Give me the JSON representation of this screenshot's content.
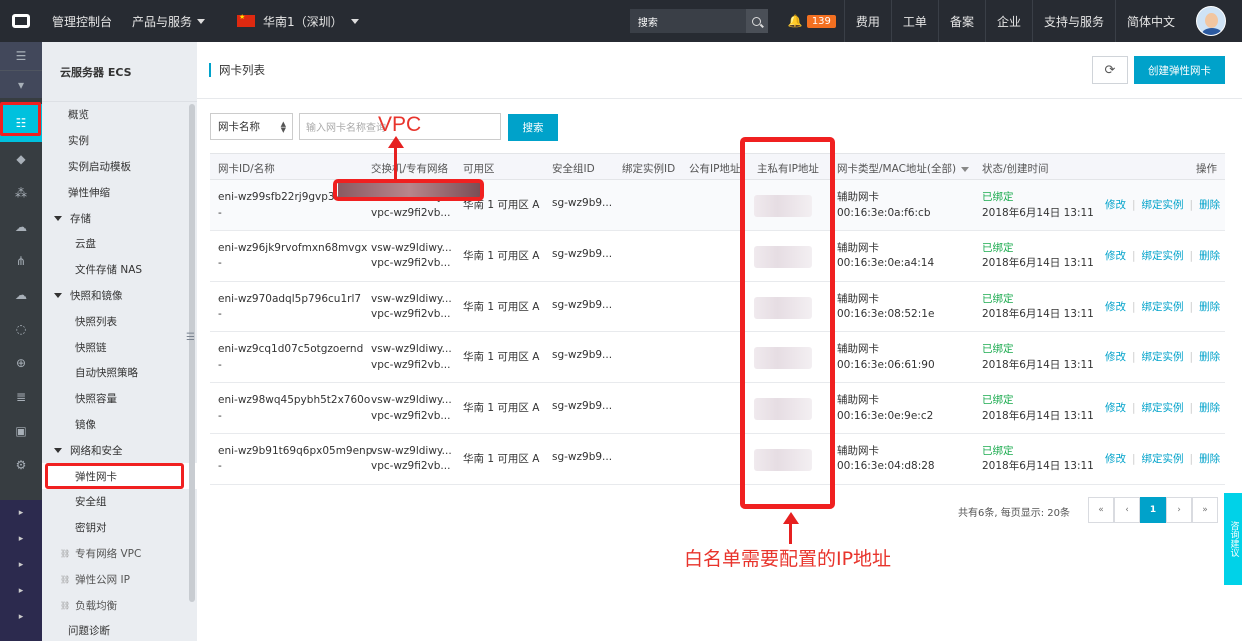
{
  "topbar": {
    "console": "管理控制台",
    "products": "产品与服务",
    "region": "华南1（深圳）",
    "search_placeholder": "搜索",
    "bell_count": "139",
    "links": [
      "费用",
      "工单",
      "备案",
      "企业",
      "支持与服务",
      "简体中文"
    ]
  },
  "rail": {
    "top_icons": [
      "menu-icon",
      "arrow-down-icon"
    ],
    "icons": [
      "ecs-icon",
      "cube-icon",
      "share-icon",
      "cloud-icon",
      "cluster-icon",
      "cloud-upload-icon",
      "cloud-outline-icon",
      "network-icon",
      "storage-icon",
      "chip-icon",
      "gear-icon",
      "more-icon"
    ],
    "lower_icons": [
      "chevron-right-icon",
      "chevron-right-icon",
      "chevron-right-icon",
      "chevron-right-icon",
      "chevron-right-icon"
    ]
  },
  "nav": {
    "title": "云服务器 ECS",
    "items": [
      {
        "label": "概览",
        "type": "item"
      },
      {
        "label": "实例",
        "type": "item"
      },
      {
        "label": "实例启动模板",
        "type": "item"
      },
      {
        "label": "弹性伸缩",
        "type": "item"
      },
      {
        "label": "存储",
        "type": "group"
      },
      {
        "label": "云盘",
        "type": "sub"
      },
      {
        "label": "文件存储 NAS",
        "type": "sub"
      },
      {
        "label": "快照和镜像",
        "type": "group"
      },
      {
        "label": "快照列表",
        "type": "sub"
      },
      {
        "label": "快照链",
        "type": "sub"
      },
      {
        "label": "自动快照策略",
        "type": "sub"
      },
      {
        "label": "快照容量",
        "type": "sub"
      },
      {
        "label": "镜像",
        "type": "sub"
      },
      {
        "label": "网络和安全",
        "type": "group"
      },
      {
        "label": "弹性网卡",
        "type": "sub",
        "current": true
      },
      {
        "label": "安全组",
        "type": "sub"
      },
      {
        "label": "密钥对",
        "type": "sub"
      },
      {
        "label": "专有网络 VPC",
        "type": "link"
      },
      {
        "label": "弹性公网 IP",
        "type": "link"
      },
      {
        "label": "负载均衡",
        "type": "link"
      },
      {
        "label": "问题诊断",
        "type": "item"
      }
    ]
  },
  "main": {
    "title": "网卡列表",
    "create_button": "创建弹性网卡",
    "filter_select": "网卡名称",
    "search_placeholder": "输入网卡名称查询",
    "search_button": "搜索",
    "columns": [
      "网卡ID/名称",
      "交换机/专有网络",
      "可用区",
      "安全组ID",
      "绑定实例ID",
      "公有IP地址",
      "主私有IP地址",
      "网卡类型/MAC地址(全部)",
      "状态/创建时间",
      "操作"
    ],
    "rows": [
      {
        "id": "eni-wz99sfb22rj9gvp3wuc",
        "name": "-",
        "vsw": "vsw-wz9ldiwy...",
        "vpc": "vpc-wz9fi2vb...",
        "zone": "华南 1 可用区 A",
        "sg": "sg-wz9b9...",
        "type": "辅助网卡",
        "mac": "00:16:3e:0a:f6:cb",
        "status": "已绑定",
        "time": "2018年6月14日 13:11"
      },
      {
        "id": "eni-wz96jk9rvofmxn68mvgx",
        "name": "-",
        "vsw": "vsw-wz9ldiwy...",
        "vpc": "vpc-wz9fi2vb...",
        "zone": "华南 1 可用区 A",
        "sg": "sg-wz9b9...",
        "type": "辅助网卡",
        "mac": "00:16:3e:0e:a4:14",
        "status": "已绑定",
        "time": "2018年6月14日 13:11"
      },
      {
        "id": "eni-wz970adql5p796cu1rl7",
        "name": "-",
        "vsw": "vsw-wz9ldiwy...",
        "vpc": "vpc-wz9fi2vb...",
        "zone": "华南 1 可用区 A",
        "sg": "sg-wz9b9...",
        "type": "辅助网卡",
        "mac": "00:16:3e:08:52:1e",
        "status": "已绑定",
        "time": "2018年6月14日 13:11"
      },
      {
        "id": "eni-wz9cq1d07c5otgzoernd",
        "name": "-",
        "vsw": "vsw-wz9ldiwy...",
        "vpc": "vpc-wz9fi2vb...",
        "zone": "华南 1 可用区 A",
        "sg": "sg-wz9b9...",
        "type": "辅助网卡",
        "mac": "00:16:3e:06:61:90",
        "status": "已绑定",
        "time": "2018年6月14日 13:11"
      },
      {
        "id": "eni-wz98wq45pybh5t2x760o",
        "name": "-",
        "vsw": "vsw-wz9ldiwy...",
        "vpc": "vpc-wz9fi2vb...",
        "zone": "华南 1 可用区 A",
        "sg": "sg-wz9b9...",
        "type": "辅助网卡",
        "mac": "00:16:3e:0e:9e:c2",
        "status": "已绑定",
        "time": "2018年6月14日 13:11"
      },
      {
        "id": "eni-wz9b91t69q6px05m9enp",
        "name": "-",
        "vsw": "vsw-wz9ldiwy...",
        "vpc": "vpc-wz9fi2vb...",
        "zone": "华南 1 可用区 A",
        "sg": "sg-wz9b9...",
        "type": "辅助网卡",
        "mac": "00:16:3e:04:d8:28",
        "status": "已绑定",
        "time": "2018年6月14日 13:11"
      }
    ],
    "actions": [
      "修改",
      "绑定实例",
      "删除"
    ],
    "pager": {
      "info": "共有6条, 每页显示: 20条",
      "buttons": [
        "«",
        "‹",
        "1",
        "›",
        "»"
      ],
      "current": "1"
    }
  },
  "annotations": {
    "vpc_label": "VPC",
    "ip_label": "白名单需要配置的IP地址",
    "color": "#f02020"
  },
  "side_tab": "咨询建议"
}
